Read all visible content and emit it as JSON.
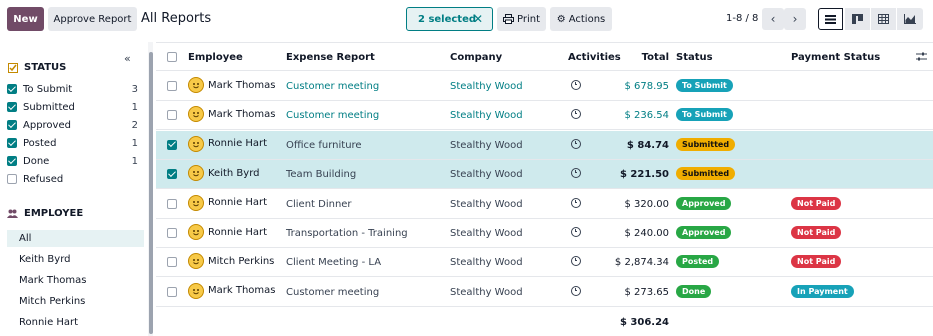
{
  "toolbar": {
    "new_label": "New",
    "approve_label": "Approve Report",
    "title": "All Reports",
    "selected_label": "2 selected",
    "print_label": "Print",
    "actions_label": "Actions",
    "pager": "1-8 / 8"
  },
  "sidebar": {
    "status_heading": "STATUS",
    "status_filters": [
      {
        "label": "To Submit",
        "count": "3",
        "checked": true
      },
      {
        "label": "Submitted",
        "count": "1",
        "checked": true
      },
      {
        "label": "Approved",
        "count": "2",
        "checked": true
      },
      {
        "label": "Posted",
        "count": "1",
        "checked": true
      },
      {
        "label": "Done",
        "count": "1",
        "checked": true
      },
      {
        "label": "Refused",
        "count": "",
        "checked": false
      }
    ],
    "employee_heading": "EMPLOYEE",
    "employees": [
      "All",
      "Keith Byrd",
      "Mark Thomas",
      "Mitch Perkins",
      "Ronnie Hart"
    ]
  },
  "table": {
    "headers": {
      "employee": "Employee",
      "report": "Expense Report",
      "company": "Company",
      "activities": "Activities",
      "total": "Total",
      "status": "Status",
      "payment": "Payment Status"
    },
    "rows": [
      {
        "employee": "Mark Thomas",
        "report": "Customer meeting",
        "company": "Stealthy Wood",
        "total": "$ 678.95",
        "status": "To Submit",
        "payment": "",
        "selected": false
      },
      {
        "employee": "Mark Thomas",
        "report": "Customer meeting",
        "company": "Stealthy Wood",
        "total": "$ 236.54",
        "status": "To Submit",
        "payment": "",
        "selected": false
      },
      {
        "employee": "Ronnie Hart",
        "report": "Office furniture",
        "company": "Stealthy Wood",
        "total": "$ 84.74",
        "status": "Submitted",
        "payment": "",
        "selected": true
      },
      {
        "employee": "Keith Byrd",
        "report": "Team Building",
        "company": "Stealthy Wood",
        "total": "$ 221.50",
        "status": "Submitted",
        "payment": "",
        "selected": true
      },
      {
        "employee": "Ronnie Hart",
        "report": "Client Dinner",
        "company": "Stealthy Wood",
        "total": "$ 320.00",
        "status": "Approved",
        "payment": "Not Paid",
        "selected": false
      },
      {
        "employee": "Ronnie Hart",
        "report": "Transportation - Training",
        "company": "Stealthy Wood",
        "total": "$ 240.00",
        "status": "Approved",
        "payment": "Not Paid",
        "selected": false
      },
      {
        "employee": "Mitch Perkins",
        "report": "Client Meeting - LA",
        "company": "Stealthy Wood",
        "total": "$ 2,874.34",
        "status": "Posted",
        "payment": "Not Paid",
        "selected": false
      },
      {
        "employee": "Mark Thomas",
        "report": "Customer meeting",
        "company": "Stealthy Wood",
        "total": "$ 273.65",
        "status": "Done",
        "payment": "In Payment",
        "selected": false
      }
    ],
    "footer_total": "$ 306.24"
  },
  "colors": {
    "primary": "#714B67",
    "accent": "#017e84",
    "selected_row": "#cfeaed"
  }
}
